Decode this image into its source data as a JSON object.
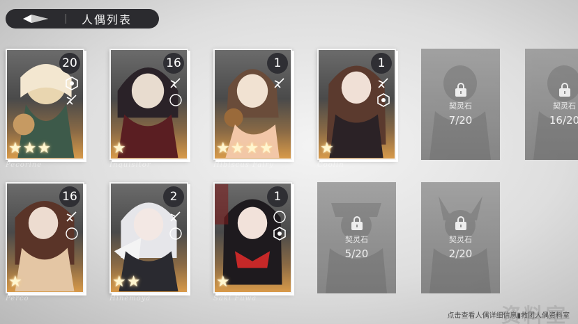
{
  "header": {
    "title": "人偶列表",
    "back_icon": "diamond-back-icon"
  },
  "dolls_row1": [
    {
      "level": "20",
      "stars": 3,
      "name": "Pecorine",
      "roles": [
        "hexagon-icon",
        "dagger-icon"
      ]
    },
    {
      "level": "16",
      "stars": 1,
      "name": "Inquisitor",
      "roles": [
        "dagger-icon",
        "moon-icon"
      ]
    },
    {
      "level": "1",
      "stars": 4,
      "name": "Hibiscus Fairy",
      "roles": [
        "dagger-icon"
      ]
    },
    {
      "level": "1",
      "stars": 1,
      "name": "Coolin",
      "roles": [
        "dagger-icon",
        "hexagon-icon"
      ]
    }
  ],
  "dolls_row2": [
    {
      "level": "16",
      "stars": 1,
      "name": "Perco",
      "roles": [
        "dagger-icon",
        "moon-icon"
      ]
    },
    {
      "level": "2",
      "stars": 2,
      "name": "Hinemoya",
      "roles": [
        "dagger-icon",
        "moon-icon"
      ]
    },
    {
      "level": "1",
      "stars": 1,
      "name": "Saki Fuwa",
      "roles": [
        "moon-icon",
        "hexagon-icon"
      ]
    }
  ],
  "locked_row1": [
    {
      "label": "契灵石",
      "progress": "7/20"
    },
    {
      "label": "契灵石",
      "progress": "16/20"
    }
  ],
  "locked_row2": [
    {
      "label": "契灵石",
      "progress": "5/20"
    },
    {
      "label": "契灵石",
      "progress": "2/20"
    }
  ],
  "footer": {
    "hint": "点击查看人偶详细信息▮救团人偶资料室",
    "watermark": "资料室"
  }
}
